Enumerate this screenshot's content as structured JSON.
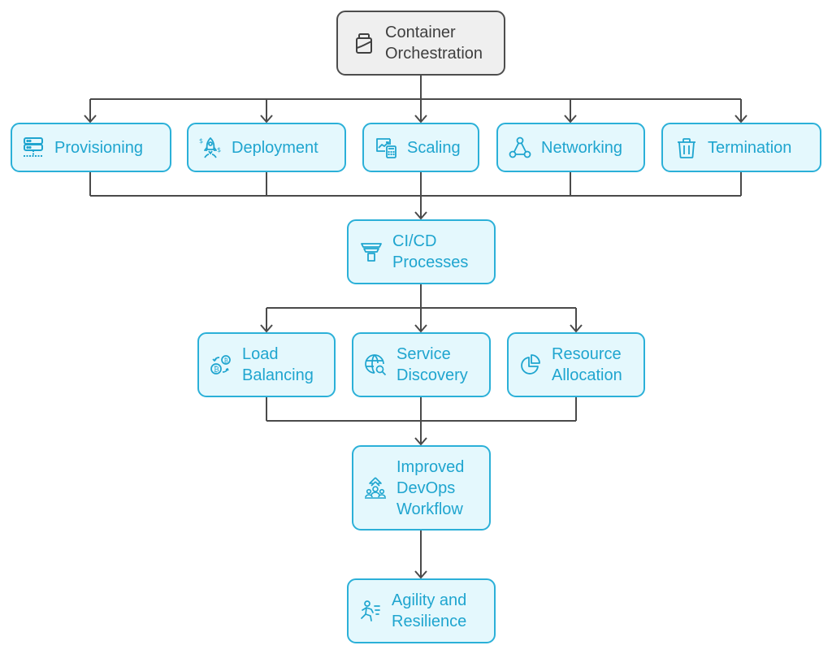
{
  "diagram": {
    "type": "flowchart",
    "colors": {
      "node_fill": "#e4f8fd",
      "node_border": "#2bb0d8",
      "node_text": "#1fa5cf",
      "root_fill": "#efefef",
      "root_border": "#4d4d4d",
      "root_text": "#3f3f3f",
      "connector": "#4a4a4a"
    },
    "nodes": {
      "root": {
        "label": "Container\nOrchestration",
        "icon": "container-jar-icon"
      },
      "provisioning": {
        "label": "Provisioning",
        "icon": "server-icon"
      },
      "deployment": {
        "label": "Deployment",
        "icon": "rocket-icon"
      },
      "scaling": {
        "label": "Scaling",
        "icon": "chart-calculator-icon"
      },
      "networking": {
        "label": "Networking",
        "icon": "network-nodes-icon"
      },
      "termination": {
        "label": "Termination",
        "icon": "trash-icon"
      },
      "cicd": {
        "label": "CI/CD\nProcesses",
        "icon": "funnel-icon"
      },
      "load_balancing": {
        "label": "Load\nBalancing",
        "icon": "coin-exchange-icon"
      },
      "service_discovery": {
        "label": "Service\nDiscovery",
        "icon": "globe-search-icon"
      },
      "resource_allocation": {
        "label": "Resource\nAllocation",
        "icon": "pie-chart-icon"
      },
      "improved_devops": {
        "label": "Improved\nDevOps\nWorkflow",
        "icon": "team-growth-icon"
      },
      "agility": {
        "label": "Agility and\nResilience",
        "icon": "running-person-icon"
      }
    },
    "edges": [
      [
        "root",
        "provisioning"
      ],
      [
        "root",
        "deployment"
      ],
      [
        "root",
        "scaling"
      ],
      [
        "root",
        "networking"
      ],
      [
        "root",
        "termination"
      ],
      [
        "provisioning",
        "cicd"
      ],
      [
        "deployment",
        "cicd"
      ],
      [
        "scaling",
        "cicd"
      ],
      [
        "networking",
        "cicd"
      ],
      [
        "termination",
        "cicd"
      ],
      [
        "cicd",
        "load_balancing"
      ],
      [
        "cicd",
        "service_discovery"
      ],
      [
        "cicd",
        "resource_allocation"
      ],
      [
        "load_balancing",
        "improved_devops"
      ],
      [
        "service_discovery",
        "improved_devops"
      ],
      [
        "resource_allocation",
        "improved_devops"
      ],
      [
        "improved_devops",
        "agility"
      ]
    ]
  }
}
